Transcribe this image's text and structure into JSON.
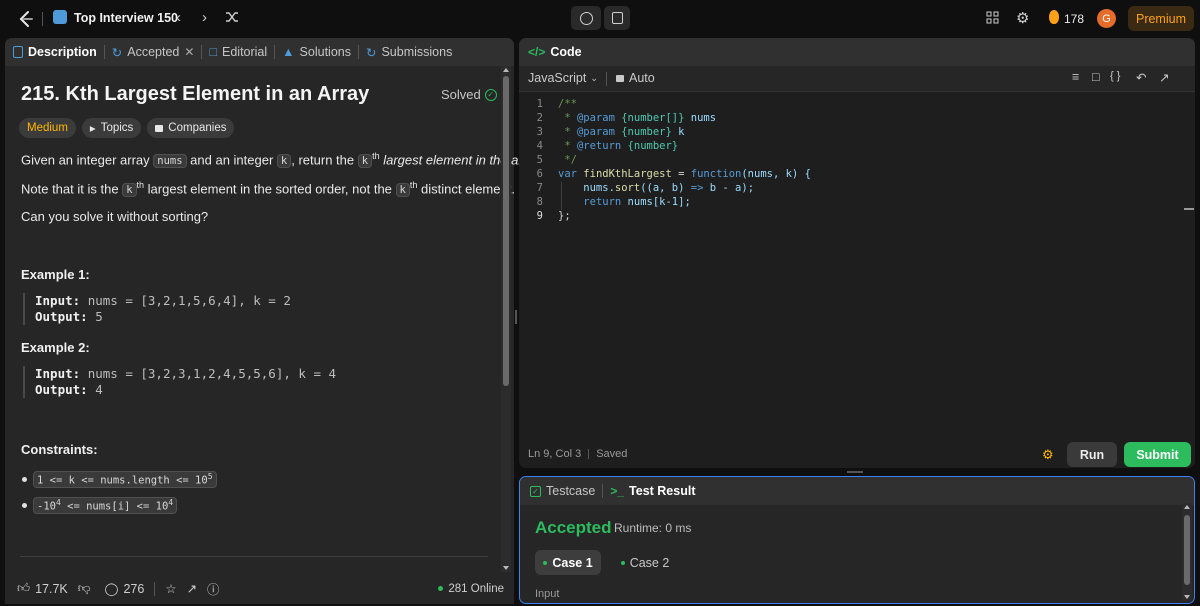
{
  "topbar": {
    "list_title": "Top Interview 150",
    "streak": "178",
    "avatar_letter": "G",
    "premium_label": "Premium"
  },
  "left_tabs": {
    "description": "Description",
    "accepted": "Accepted",
    "editorial": "Editorial",
    "solutions": "Solutions",
    "submissions": "Submissions"
  },
  "problem": {
    "title": "215. Kth Largest Element in an Array",
    "solved_label": "Solved",
    "difficulty": "Medium",
    "topics_label": "Topics",
    "companies_label": "Companies",
    "desc_pre": "Given an integer array",
    "desc_nums": "nums",
    "desc_mid": "and an integer",
    "desc_k": "k",
    "desc_ret": ", return the",
    "desc_kth": "k",
    "desc_sup": "th",
    "desc_tail": "largest element in the array.",
    "note_pre": "Note that it is the",
    "note_k": "k",
    "note_sup": "th",
    "note_mid": "largest element in the sorted order, not the",
    "note_k2": "k",
    "note_sup2": "th",
    "note_tail": "distinct element.",
    "challenge": "Can you solve it without sorting?",
    "example1_title": "Example 1:",
    "example1_input_label": "Input:",
    "example1_input": "nums = [3,2,1,5,6,4], k = 2",
    "example1_output_label": "Output:",
    "example1_output": "5",
    "example2_title": "Example 2:",
    "example2_input_label": "Input:",
    "example2_input": "nums = [3,2,3,1,2,4,5,5,6], k = 4",
    "example2_output_label": "Output:",
    "example2_output": "4",
    "constraints_title": "Constraints:",
    "c1_pre": "1 <= k <= nums.length <= 10",
    "c1_sup": "5",
    "c2_a": "-10",
    "c2_sup": "4",
    "c2_b": "<= nums[i] <=",
    "c2_c": "10",
    "c2_sup2": "4"
  },
  "footer": {
    "likes": "17.7K",
    "comments": "276",
    "online": "281 Online"
  },
  "editor": {
    "header": "Code",
    "language": "JavaScript",
    "auto_label": "Auto",
    "status": "Ln 9, Col 3",
    "saved": "Saved",
    "run_label": "Run",
    "submit_label": "Submit",
    "line_numbers": [
      "1",
      "2",
      "3",
      "4",
      "5",
      "6",
      "7",
      "8",
      "9"
    ],
    "code": {
      "l1": "/**",
      "l2a": " * ",
      "l2b": "@param",
      "l2c": " {number[]} ",
      "l2d": "nums",
      "l3a": " * ",
      "l3b": "@param",
      "l3c": " {number} ",
      "l3d": "k",
      "l4a": " * ",
      "l4b": "@return",
      "l4c": " {number}",
      "l5": " */",
      "l6a": "var ",
      "l6b": "findKthLargest",
      "l6c": " = ",
      "l6d": "function",
      "l6e": "(nums, k) {",
      "l7a": "    nums.",
      "l7b": "sort",
      "l7c": "((a, b) ",
      "l7d": "=>",
      "l7e": " b - a);",
      "l8a": "    ",
      "l8b": "return",
      "l8c": " nums[k-1];",
      "l9": "};"
    }
  },
  "results": {
    "testcase_tab": "Testcase",
    "result_tab": "Test Result",
    "verdict": "Accepted",
    "runtime": "Runtime: 0 ms",
    "case1": "Case 1",
    "case2": "Case 2",
    "input_label": "Input"
  },
  "colors": {
    "accent_green": "#2cbb5d",
    "medium_yellow": "#ffb800",
    "premium_orange": "#ffa116",
    "focus_blue": "#3b82f6"
  }
}
